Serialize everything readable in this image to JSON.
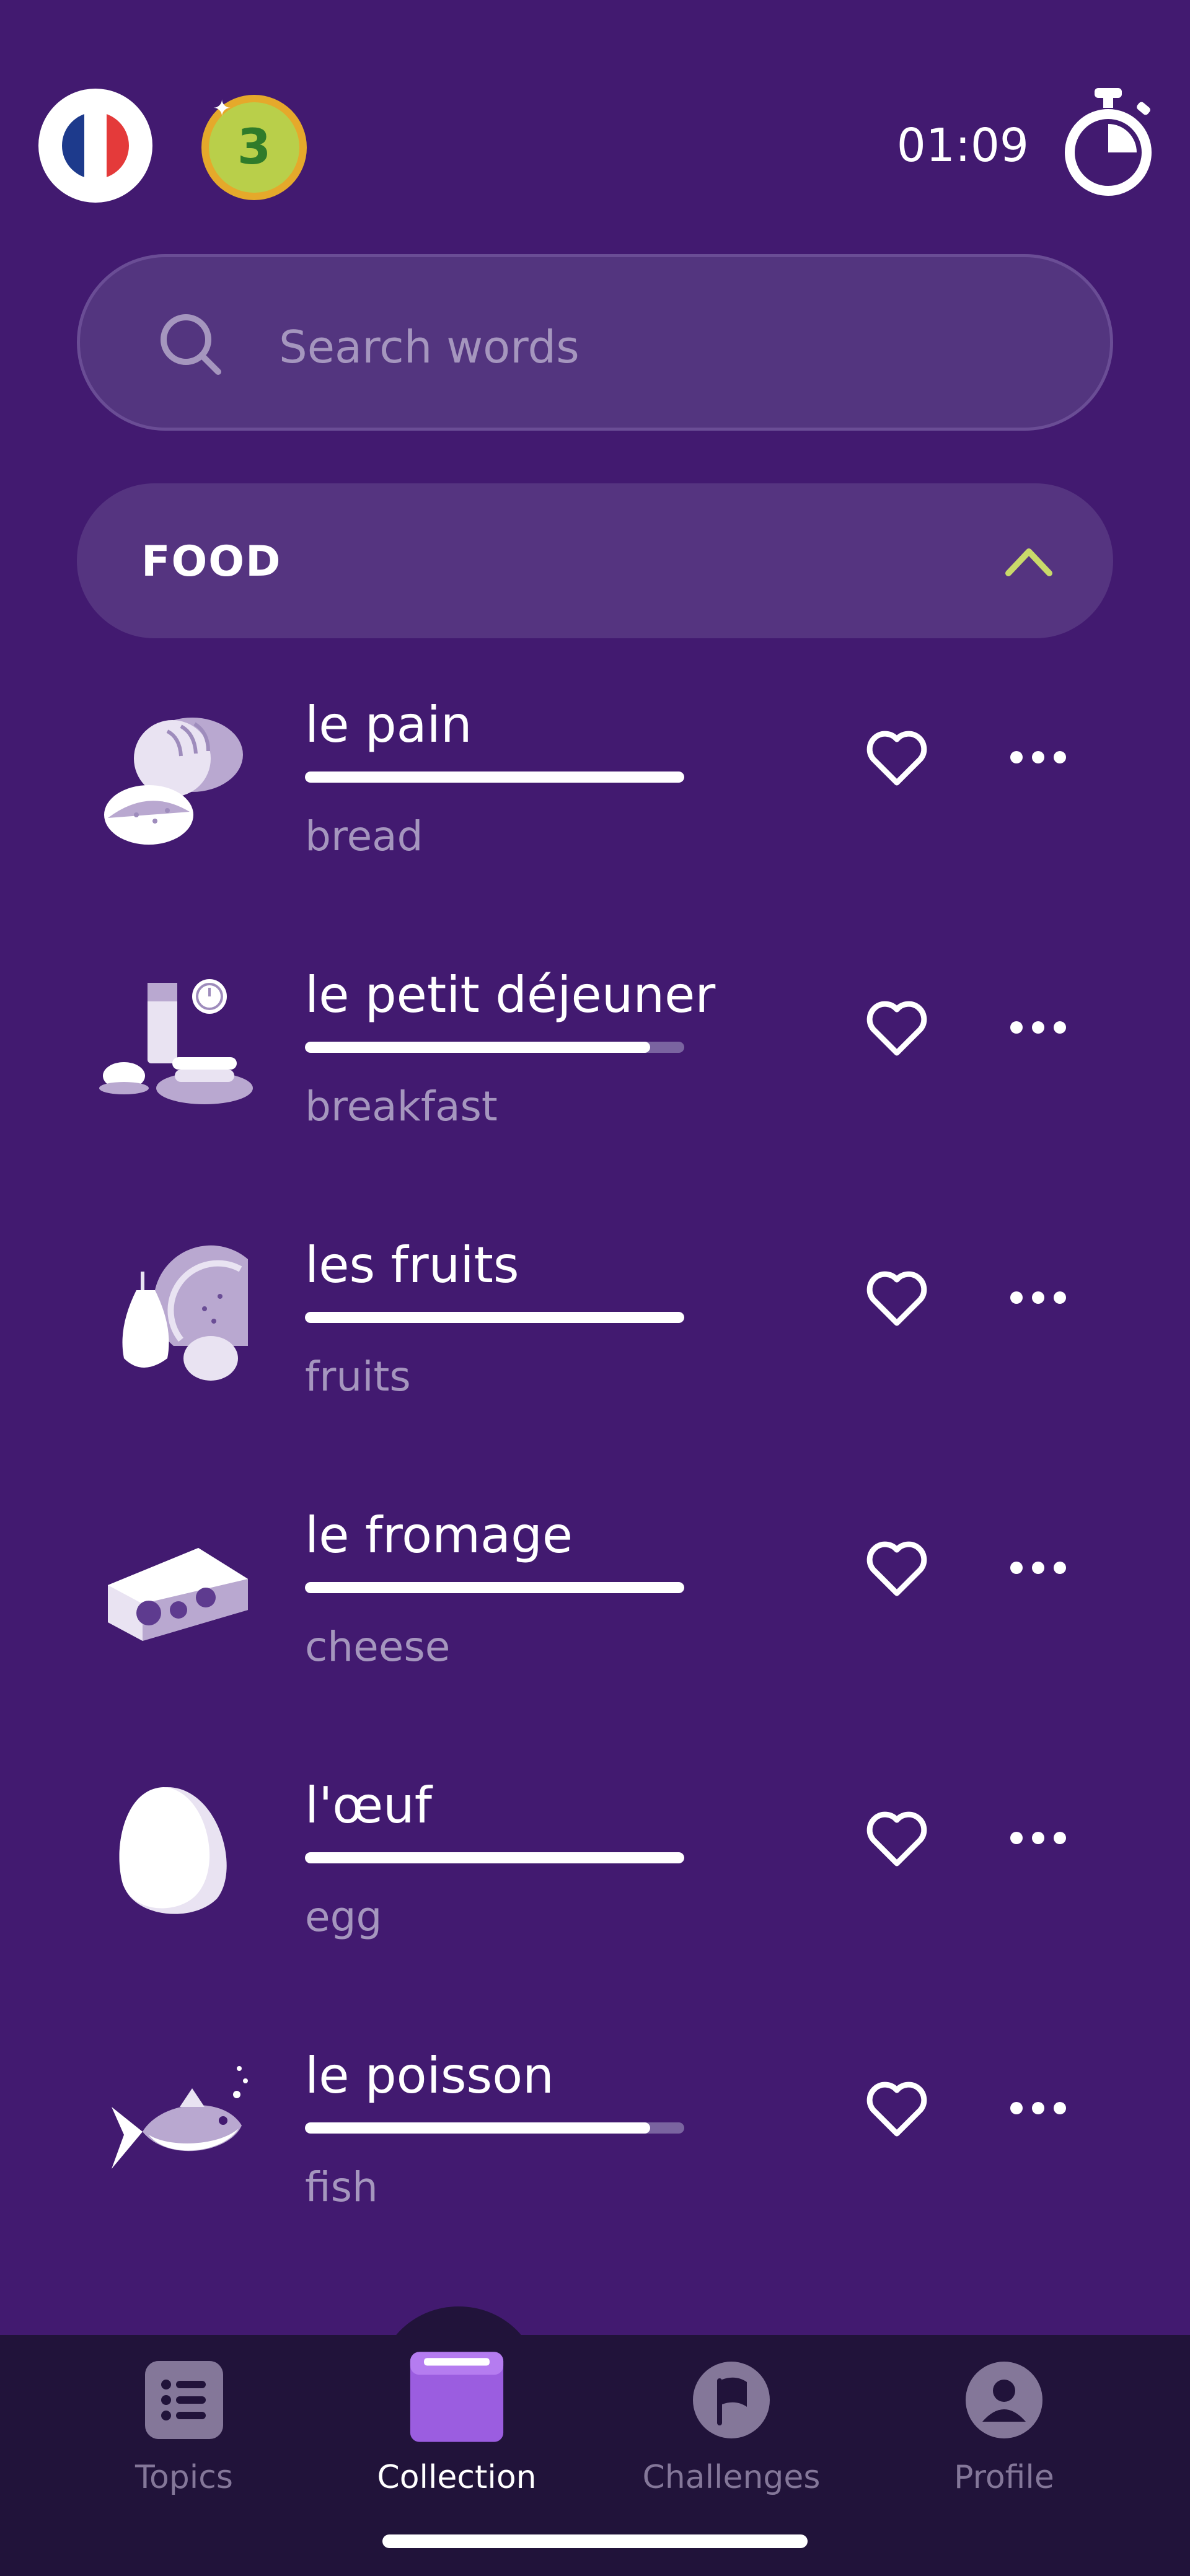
{
  "header": {
    "language_flag_colors": [
      "#1D3A8C",
      "#FFFFFF",
      "#E43A3A"
    ],
    "level": "3",
    "timer": "01:09"
  },
  "search": {
    "placeholder": "Search words"
  },
  "category": {
    "title": "FOOD"
  },
  "words": [
    {
      "word": "le pain",
      "translation": "bread",
      "progress": 1.0,
      "thumb_icon": "bread-icon"
    },
    {
      "word": "le petit déjeuner",
      "translation": "breakfast",
      "progress": 0.91,
      "thumb_icon": "breakfast-icon"
    },
    {
      "word": "les fruits",
      "translation": "fruits",
      "progress": 1.0,
      "thumb_icon": "fruits-icon"
    },
    {
      "word": "le fromage",
      "translation": "cheese",
      "progress": 1.0,
      "thumb_icon": "cheese-icon"
    },
    {
      "word": "l'œuf",
      "translation": "egg",
      "progress": 1.0,
      "thumb_icon": "egg-icon"
    },
    {
      "word": "le poisson",
      "translation": "fish",
      "progress": 0.91,
      "thumb_icon": "fish-icon"
    }
  ],
  "nav": {
    "items": [
      {
        "label": "Topics",
        "icon": "list-icon"
      },
      {
        "label": "Collection",
        "icon": "book-icon"
      },
      {
        "label": "Challenges",
        "icon": "flag-icon"
      },
      {
        "label": "Profile",
        "icon": "person-icon"
      }
    ],
    "active": "Collection"
  },
  "colors": {
    "background": "#421A70",
    "surface": "#553480",
    "accent_chevron": "#C9D96A",
    "nav_background": "#21133A",
    "active_nav": "#9B5DE0",
    "muted_text": "#A596BE"
  }
}
